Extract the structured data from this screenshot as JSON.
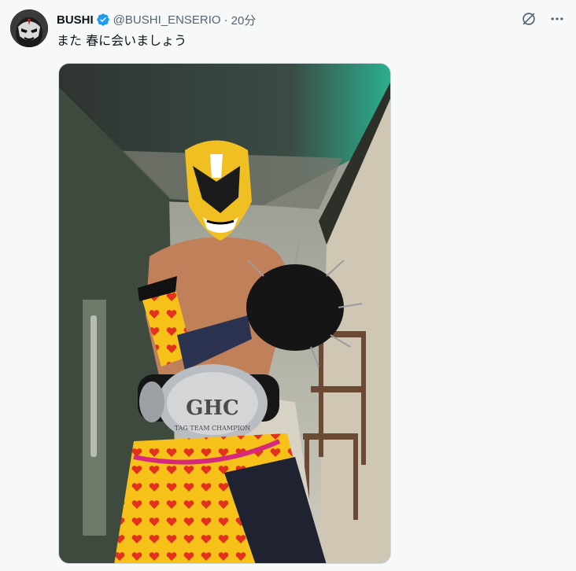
{
  "tweet": {
    "author_name": "BUSHI",
    "handle": "@BUSHI_ENSERIO",
    "separator": "·",
    "time": "20分",
    "text": "また 春に会いましょう",
    "verified": true,
    "verified_color": "#1d9bf0"
  },
  "media": {
    "belt_text": "GHC",
    "belt_subtext": "TAG TEAM CHAMPION"
  },
  "icons": {
    "grok": "grok-icon",
    "more": "more-icon"
  }
}
